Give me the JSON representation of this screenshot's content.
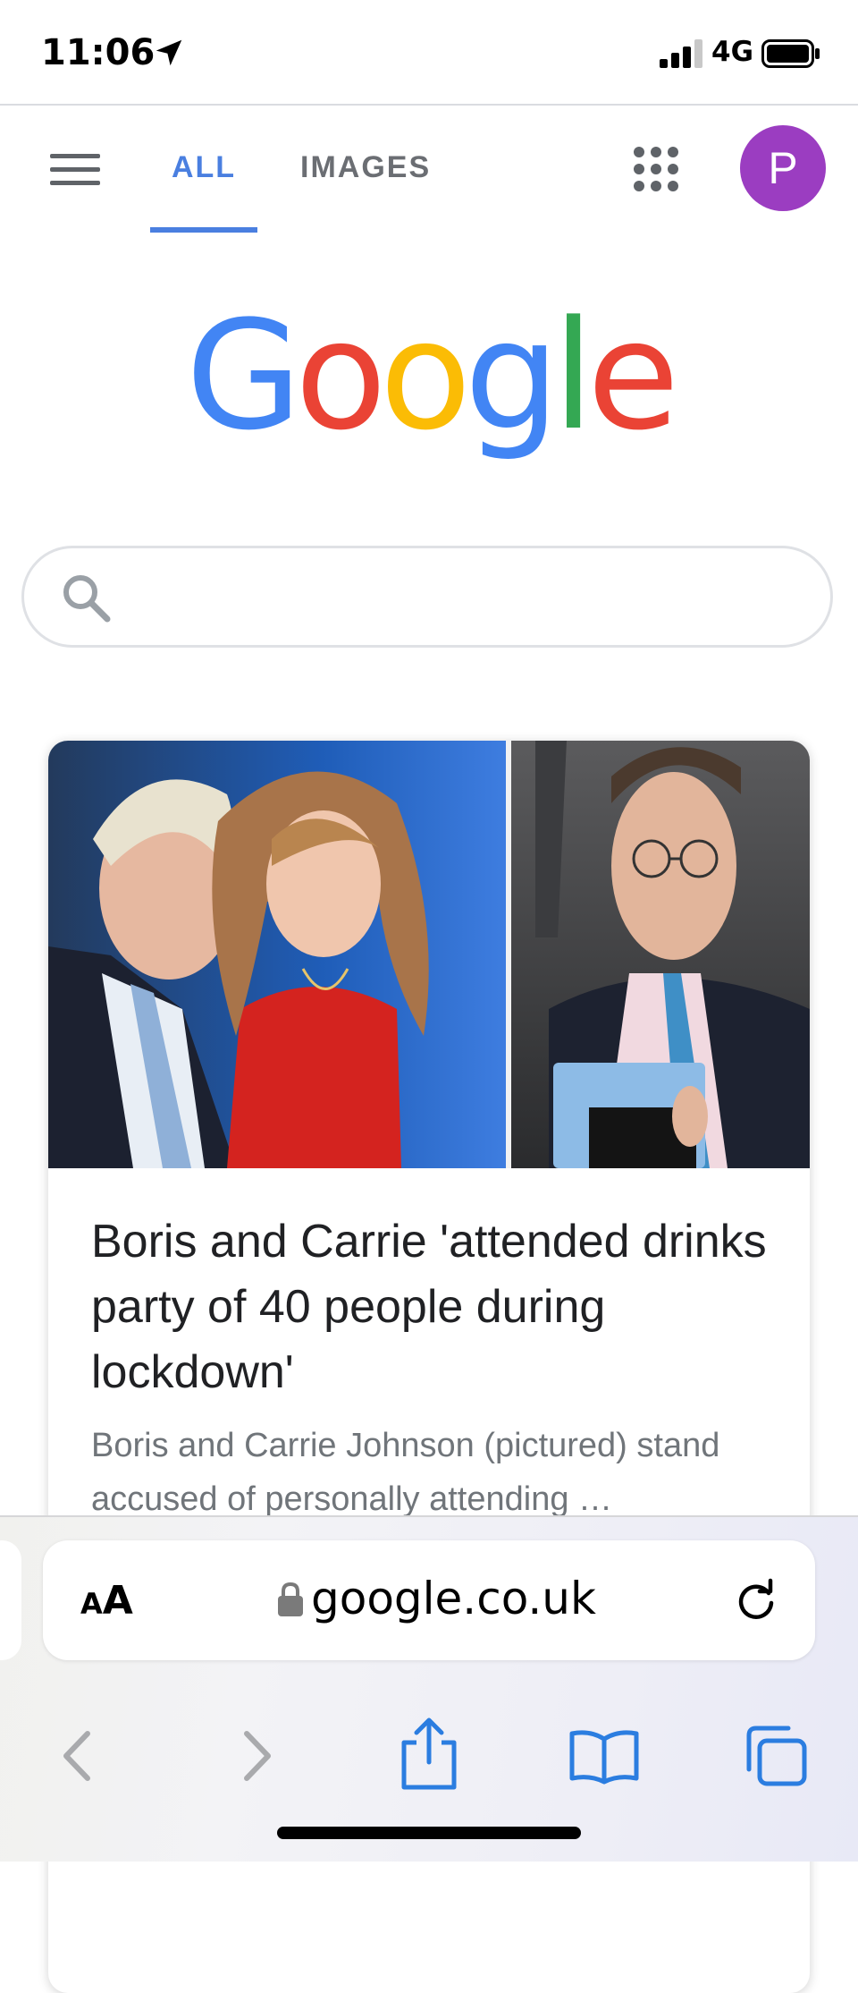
{
  "status_bar": {
    "time": "11:06",
    "network": "4G",
    "icons": [
      "location-arrow-icon",
      "signal-bars-icon",
      "battery-icon"
    ]
  },
  "header": {
    "menu_icon": "hamburger-menu-icon",
    "tabs": [
      {
        "label": "ALL",
        "active": true
      },
      {
        "label": "IMAGES",
        "active": false
      }
    ],
    "apps_icon": "apps-grid-icon",
    "avatar_initial": "P",
    "active_tab_color": "#4a7fe0",
    "avatar_color": "#9b3dc1"
  },
  "logo": {
    "letters": [
      {
        "char": "G",
        "color": "#4285F4"
      },
      {
        "char": "o",
        "color": "#EA4335"
      },
      {
        "char": "o",
        "color": "#FBBC05"
      },
      {
        "char": "g",
        "color": "#4285F4"
      },
      {
        "char": "l",
        "color": "#34A853"
      },
      {
        "char": "e",
        "color": "#EA4335"
      }
    ]
  },
  "search": {
    "icon": "search-icon",
    "value": "",
    "placeholder": ""
  },
  "news_card": {
    "image": "news-photo-collage",
    "title": "Boris and Carrie 'attended drinks party of 40 people during lockdown'",
    "snippet": "Boris and Carrie Johnson (pictured) stand accused of personally attending …"
  },
  "browser": {
    "text_size_small": "A",
    "text_size_big": "A",
    "lock_icon": "lock-icon",
    "url": "google.co.uk",
    "reload_icon": "reload-icon",
    "toolbar_icons": [
      "back-icon",
      "forward-icon",
      "share-icon",
      "bookmarks-icon",
      "tabs-icon"
    ]
  }
}
